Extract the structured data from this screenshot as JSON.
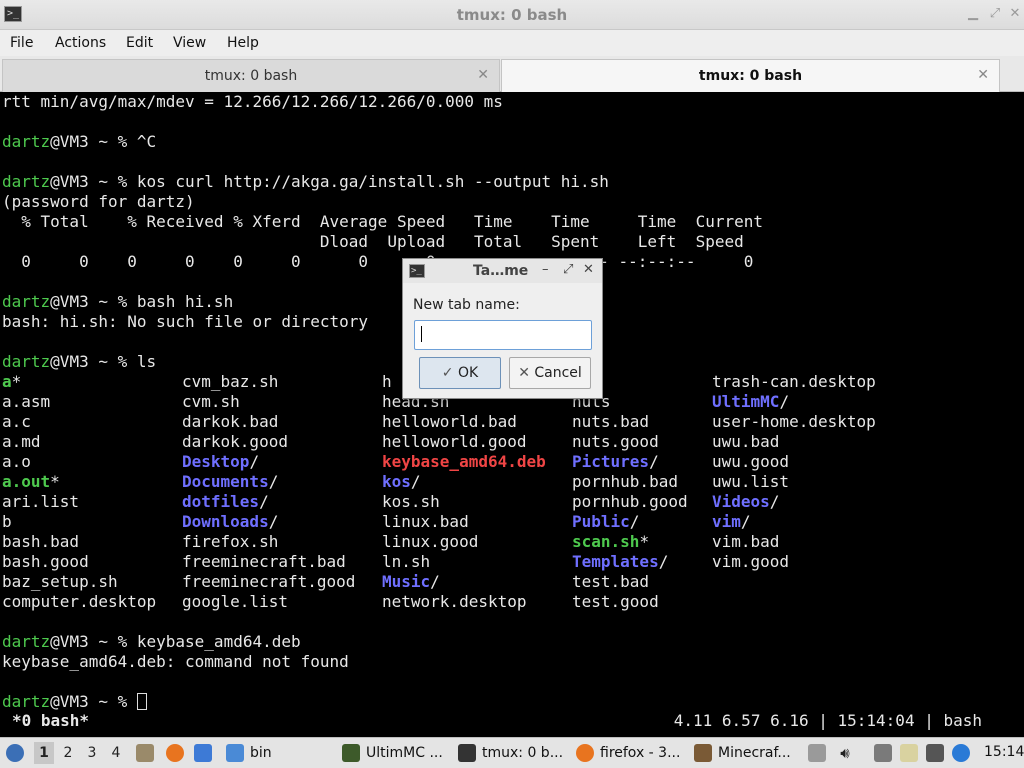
{
  "window": {
    "title": "tmux: 0 bash"
  },
  "menu": [
    "File",
    "Actions",
    "Edit",
    "View",
    "Help"
  ],
  "tabs": [
    {
      "label": "tmux: 0 bash",
      "active": false
    },
    {
      "label": "tmux: 0 bash",
      "active": true
    }
  ],
  "terminal": {
    "lines": [
      "rtt min/avg/max/mdev = 12.266/12.266/12.266/0.000 ms",
      "",
      "dartz@VM3 ~ % ^C",
      "",
      "dartz@VM3 ~ % kos curl http://akga.ga/install.sh --output hi.sh",
      "(password for dartz)",
      "  % Total    % Received % Xferd  Average Speed   Time    Time     Time  Current",
      "                                 Dload  Upload   Total   Spent    Left  Speed",
      "  0     0    0     0    0     0      0      0 --:--:-- --:--:-- --:--:--     0",
      "",
      "dartz@VM3 ~ % bash hi.sh",
      "bash: hi.sh: No such file or directory",
      "",
      "dartz@VM3 ~ % ls"
    ],
    "ls_columns": [
      [
        {
          "t": "a",
          "c": "gb",
          "s": "*"
        },
        {
          "t": "a.asm"
        },
        {
          "t": "a.c"
        },
        {
          "t": "a.md"
        },
        {
          "t": "a.o"
        },
        {
          "t": "a.out",
          "c": "gb",
          "s": "*"
        },
        {
          "t": "ari.list"
        },
        {
          "t": "b"
        },
        {
          "t": "bash.bad"
        },
        {
          "t": "bash.good"
        },
        {
          "t": "baz_setup.sh"
        },
        {
          "t": "computer.desktop"
        }
      ],
      [
        {
          "t": "cvm_baz.sh"
        },
        {
          "t": "cvm.sh"
        },
        {
          "t": "darkok.bad"
        },
        {
          "t": "darkok.good"
        },
        {
          "t": "Desktop",
          "c": "b",
          "s": "/"
        },
        {
          "t": "Documents",
          "c": "b",
          "s": "/"
        },
        {
          "t": "dotfiles",
          "c": "b",
          "s": "/"
        },
        {
          "t": "Downloads",
          "c": "b",
          "s": "/"
        },
        {
          "t": "firefox.sh"
        },
        {
          "t": "freeminecraft.bad"
        },
        {
          "t": "freeminecraft.good"
        },
        {
          "t": "google.list"
        }
      ],
      [
        {
          "t": "h"
        },
        {
          "t": "head.sh"
        },
        {
          "t": "helloworld.bad"
        },
        {
          "t": "helloworld.good"
        },
        {
          "t": "keybase_amd64.deb",
          "c": "r"
        },
        {
          "t": "kos",
          "c": "b",
          "s": "/"
        },
        {
          "t": "kos.sh"
        },
        {
          "t": "linux.bad"
        },
        {
          "t": "linux.good"
        },
        {
          "t": "ln.sh"
        },
        {
          "t": "Music",
          "c": "b",
          "s": "/"
        },
        {
          "t": "network.desktop"
        }
      ],
      [
        {
          "t": ""
        },
        {
          "t": "nuts"
        },
        {
          "t": "nuts.bad"
        },
        {
          "t": "nuts.good"
        },
        {
          "t": "Pictures",
          "c": "b",
          "s": "/"
        },
        {
          "t": "pornhub.bad"
        },
        {
          "t": "pornhub.good"
        },
        {
          "t": "Public",
          "c": "b",
          "s": "/"
        },
        {
          "t": "scan.sh",
          "c": "gb",
          "s": "*"
        },
        {
          "t": "Templates",
          "c": "b",
          "s": "/"
        },
        {
          "t": "test.bad"
        },
        {
          "t": "test.good"
        }
      ],
      [
        {
          "t": "trash-can.desktop"
        },
        {
          "t": "UltimMC",
          "c": "b",
          "s": "/"
        },
        {
          "t": "user-home.desktop"
        },
        {
          "t": "uwu.bad"
        },
        {
          "t": "uwu.good"
        },
        {
          "t": "uwu.list"
        },
        {
          "t": "Videos",
          "c": "b",
          "s": "/"
        },
        {
          "t": "vim",
          "c": "b",
          "s": "/"
        },
        {
          "t": "vim.bad"
        },
        {
          "t": "vim.good"
        },
        {
          "t": ""
        },
        {
          "t": ""
        }
      ]
    ],
    "after_lines": [
      "",
      "dartz@VM3 ~ % keybase_amd64.deb",
      "keybase_amd64.deb: command not found",
      "",
      "dartz@VM3 ~ % "
    ],
    "prompt_user": "dartz"
  },
  "status": {
    "left": "*0 bash*",
    "right": "4.11 6.57 6.16 | 15:14:04 | bash"
  },
  "dialog": {
    "title": "Ta…me",
    "label": "New tab name:",
    "value": "",
    "ok_label": "OK",
    "cancel_label": "Cancel"
  },
  "panel": {
    "workspaces": [
      "1",
      "2",
      "3",
      "4"
    ],
    "tasks": [
      {
        "label": "bin",
        "icon": "folder-icon"
      },
      {
        "label": "UltimMC ...",
        "icon": "ultimmc-icon"
      },
      {
        "label": "tmux: 0 b...",
        "icon": "terminal-icon"
      },
      {
        "label": "firefox - 3...",
        "icon": "firefox-icon"
      },
      {
        "label": "Minecraf...",
        "icon": "minecraft-icon"
      }
    ],
    "clock": "15:14"
  }
}
